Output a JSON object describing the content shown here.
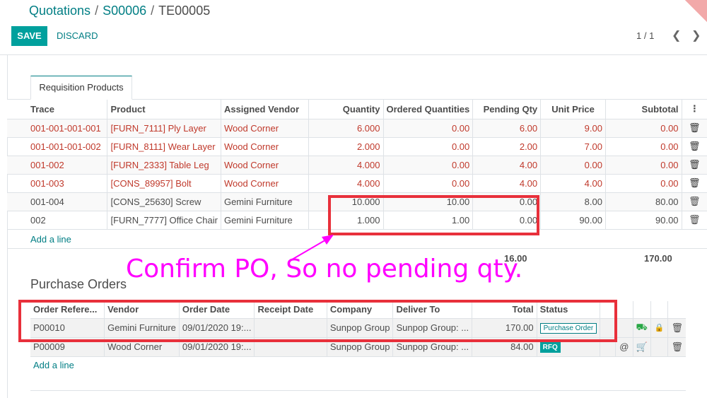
{
  "breadcrumb": {
    "level1": "Quotations",
    "level2": "S00006",
    "current": "TE00005"
  },
  "toolbar": {
    "save_label": "SAVE",
    "discard_label": "DISCARD"
  },
  "pager": {
    "value": "1 / 1"
  },
  "tab": {
    "label": "Requisition Products"
  },
  "requisition": {
    "headers": [
      "Trace",
      "Product",
      "Assigned Vendor",
      "Quantity",
      "Ordered Quantities",
      "Pending Qty",
      "Unit Price",
      "Subtotal"
    ],
    "rows": [
      {
        "trace": "001-001-001-001",
        "product": "[FURN_7111] Ply Layer",
        "vendor": "Wood Corner",
        "qty": "6.000",
        "ordered": "0.00",
        "pending": "6.00",
        "price": "9.00",
        "subtotal": "0.00"
      },
      {
        "trace": "001-001-001-002",
        "product": "[FURN_8111] Wear Layer",
        "vendor": "Wood Corner",
        "qty": "2.000",
        "ordered": "0.00",
        "pending": "2.00",
        "price": "7.00",
        "subtotal": "0.00"
      },
      {
        "trace": "001-002",
        "product": "[FURN_2333] Table Leg",
        "vendor": "Wood Corner",
        "qty": "4.000",
        "ordered": "0.00",
        "pending": "4.00",
        "price": "0.00",
        "subtotal": "0.00"
      },
      {
        "trace": "001-003",
        "product": "[CONS_89957] Bolt",
        "vendor": "Wood Corner",
        "qty": "4.000",
        "ordered": "0.00",
        "pending": "4.00",
        "price": "4.00",
        "subtotal": "0.00"
      },
      {
        "trace": "001-004",
        "product": "[CONS_25630] Screw",
        "vendor": "Gemini Furniture",
        "qty": "10.000",
        "ordered": "10.00",
        "pending": "0.00",
        "price": "8.00",
        "subtotal": "80.00"
      },
      {
        "trace": "002",
        "product": "[FURN_7777] Office Chair",
        "vendor": "Gemini Furniture",
        "qty": "1.000",
        "ordered": "1.00",
        "pending": "0.00",
        "price": "90.00",
        "subtotal": "90.00"
      }
    ],
    "add_line": "Add a line",
    "total_pending": "16.00",
    "total_subtotal": "170.00"
  },
  "purchase_orders": {
    "title": "Purchase Orders",
    "headers": [
      "Order Refere...",
      "Vendor",
      "Order Date",
      "Receipt Date",
      "Company",
      "Deliver To",
      "Total",
      "Status"
    ],
    "rows": [
      {
        "ref": "P00010",
        "vendor": "Gemini Furniture",
        "order_date": "09/01/2020 19:...",
        "receipt_date": "",
        "company": "Sunpop Group",
        "deliver_to": "Sunpop Group: ...",
        "total": "170.00",
        "status": "Purchase Order"
      },
      {
        "ref": "P00009",
        "vendor": "Wood Corner",
        "order_date": "09/01/2020 19:...",
        "receipt_date": "",
        "company": "Sunpop Group",
        "deliver_to": "Sunpop Group: ...",
        "total": "84.00",
        "status": "RFQ"
      }
    ],
    "add_line": "Add a line"
  },
  "annotation": {
    "text": "Confirm PO, So no pending qty."
  },
  "colors": {
    "accent": "#017e84",
    "save": "#00a09d",
    "annotation_box": "#e8303b",
    "annotation_text": "#ff00ff"
  }
}
